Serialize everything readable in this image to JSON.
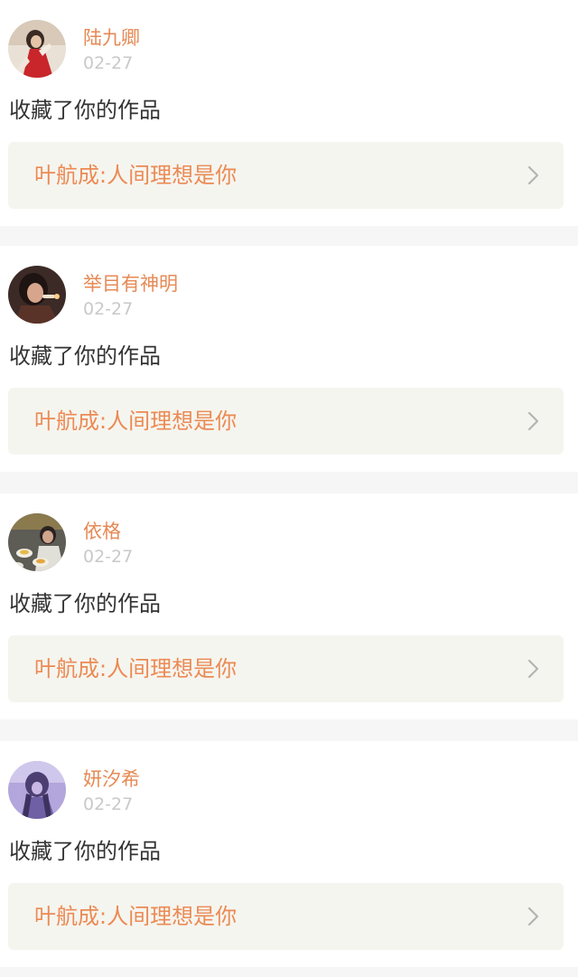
{
  "notifications": [
    {
      "username": "陆九卿",
      "date": "02-27",
      "action_text": "收藏了你的作品",
      "work_title": "叶航成:人间理想是你",
      "avatar_icon": "avatar-portrait-red-dress-icon"
    },
    {
      "username": "举目有神明",
      "date": "02-27",
      "action_text": "收藏了你的作品",
      "work_title": "叶航成:人间理想是你",
      "avatar_icon": "avatar-portrait-dark-icon"
    },
    {
      "username": "依格",
      "date": "02-27",
      "action_text": "收藏了你的作品",
      "work_title": "叶航成:人间理想是你",
      "avatar_icon": "avatar-dining-photo-icon"
    },
    {
      "username": "妍汐希",
      "date": "02-27",
      "action_text": "收藏了你的作品",
      "work_title": "叶航成:人间理想是你",
      "avatar_icon": "avatar-purple-portrait-icon"
    }
  ],
  "colors": {
    "username": "#e58a55",
    "date": "#c9c9c9",
    "action_text": "#333333",
    "work_title": "#ec8a54",
    "link_background": "#f5f5ef",
    "page_background": "#f6f6f6",
    "card_background": "#ffffff",
    "chevron": "#b4b4b4"
  }
}
